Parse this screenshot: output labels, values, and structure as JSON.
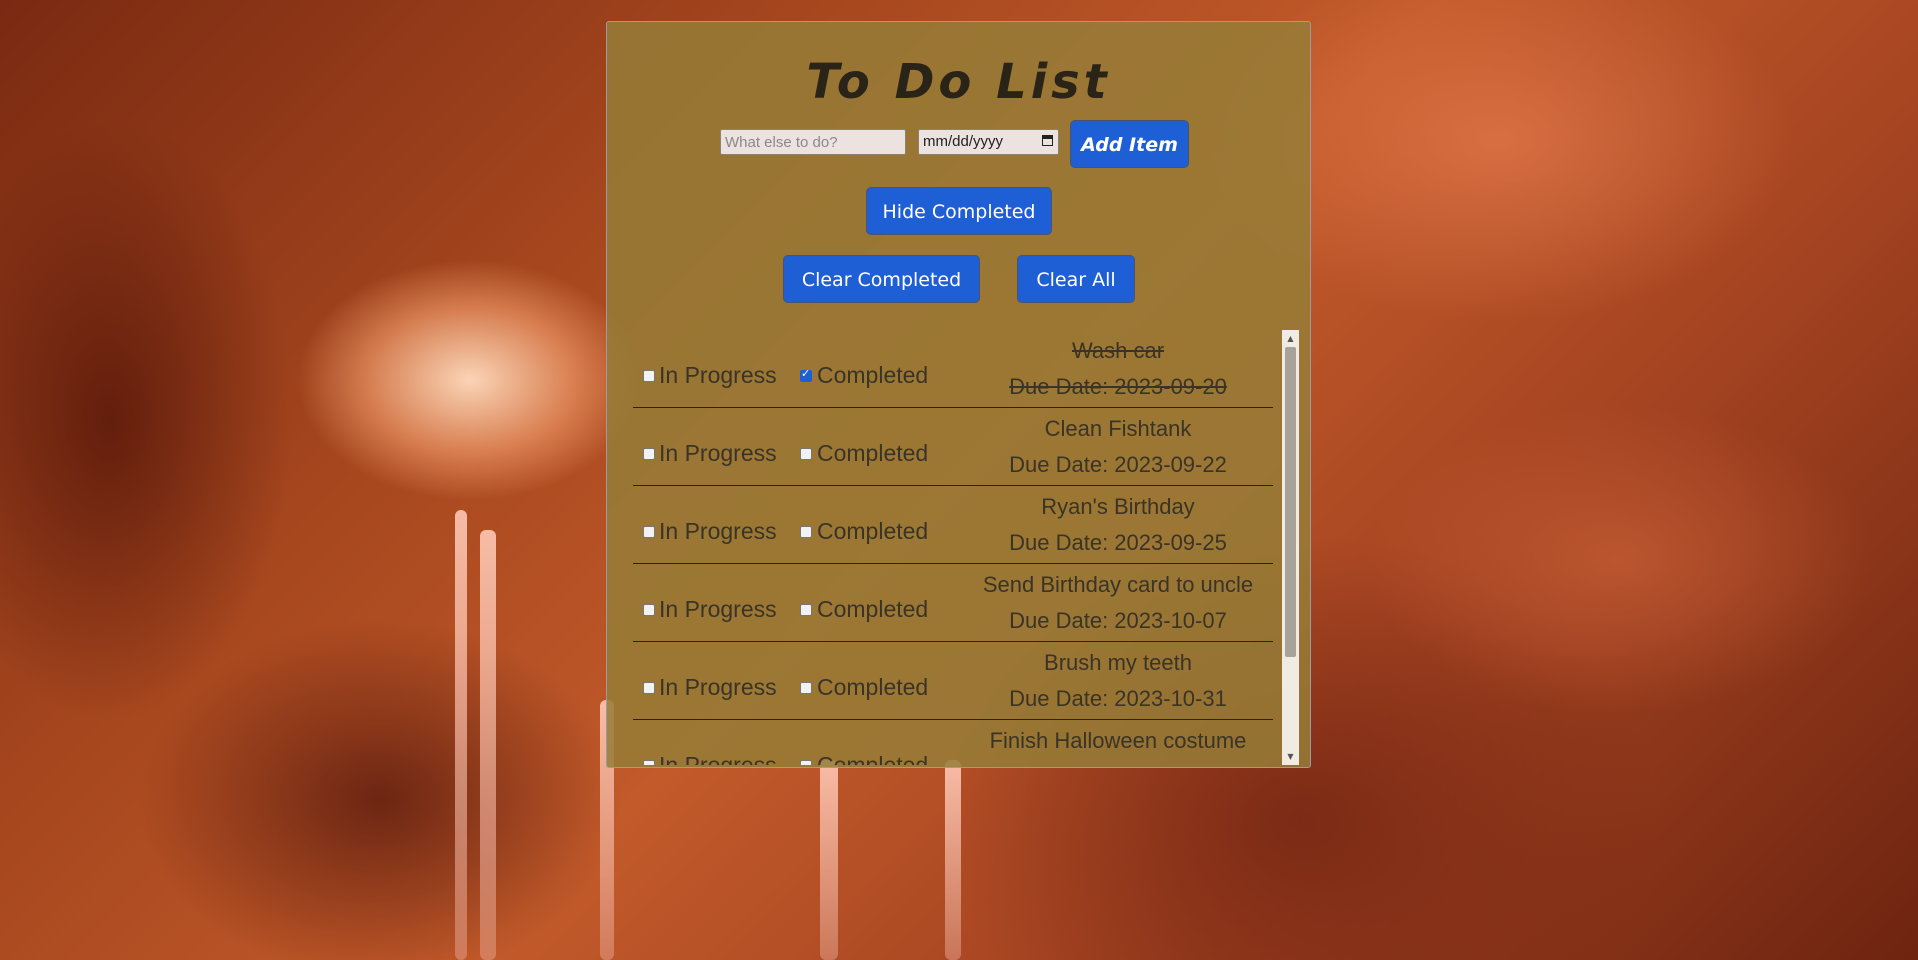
{
  "app": {
    "title": "To Do List"
  },
  "add_form": {
    "task_placeholder": "What else to do?",
    "date_placeholder": "mm/dd/yyyy",
    "add_label": "Add Item",
    "calendar_icon": "calendar-icon"
  },
  "controls": {
    "hide_completed_label": "Hide Completed",
    "clear_completed_label": "Clear Completed",
    "clear_all_label": "Clear All"
  },
  "list": {
    "in_progress_label": "In Progress",
    "completed_label": "Completed",
    "items": [
      {
        "name": "Wash car",
        "due": "Due Date: 2023-09-20",
        "in_progress": false,
        "completed": true
      },
      {
        "name": "Clean Fishtank",
        "due": "Due Date: 2023-09-22",
        "in_progress": false,
        "completed": false
      },
      {
        "name": "Ryan's Birthday",
        "due": "Due Date: 2023-09-25",
        "in_progress": false,
        "completed": false
      },
      {
        "name": "Send Birthday card to uncle",
        "due": "Due Date: 2023-10-07",
        "in_progress": false,
        "completed": false
      },
      {
        "name": "Brush my teeth",
        "due": "Due Date: 2023-10-31",
        "in_progress": false,
        "completed": false
      },
      {
        "name": "Finish Halloween costume",
        "due": "",
        "in_progress": false,
        "completed": false
      }
    ]
  },
  "colors": {
    "button": "#1e5fd6",
    "panel": "#967d37",
    "text": "#3a3426"
  }
}
